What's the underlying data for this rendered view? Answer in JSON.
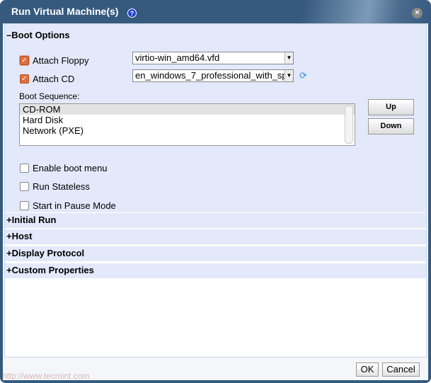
{
  "dialog": {
    "title": "Run Virtual Machine(s)",
    "help": "?",
    "close": "×"
  },
  "boot_options": {
    "header": "Boot Options",
    "toggle": "–",
    "attach_floppy": {
      "label": "Attach Floppy",
      "checked": true,
      "value": "virtio-win_amd64.vfd"
    },
    "attach_cd": {
      "label": "Attach CD",
      "checked": true,
      "value": "en_windows_7_professional_with_sp"
    },
    "boot_sequence_label": "Boot Sequence:",
    "boot_sequence": [
      "CD-ROM",
      "Hard Disk",
      "Network (PXE)"
    ],
    "up": "Up",
    "down": "Down",
    "enable_boot_menu": "Enable boot menu",
    "run_stateless": "Run Stateless",
    "start_paused": "Start in Pause Mode"
  },
  "sections": [
    {
      "toggle": "+",
      "label": "Initial Run"
    },
    {
      "toggle": "+",
      "label": "Host"
    },
    {
      "toggle": "+",
      "label": "Display Protocol"
    },
    {
      "toggle": "+",
      "label": "Custom Properties"
    }
  ],
  "footer": {
    "ok": "OK",
    "cancel": "Cancel"
  },
  "watermark": "http://www.tecmint.com"
}
